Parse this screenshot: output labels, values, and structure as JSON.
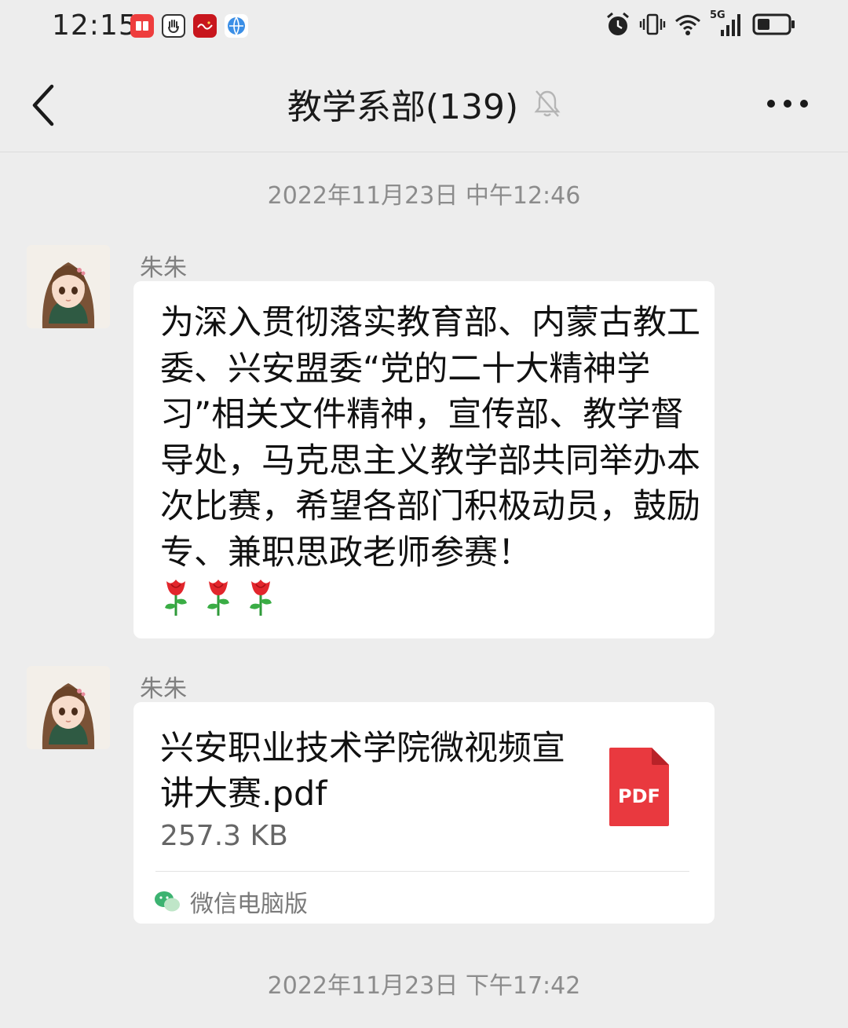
{
  "status_bar": {
    "time": "12:15",
    "network": "5G",
    "icons": [
      "reader-app-icon",
      "hand-app-icon",
      "study-app-icon",
      "globe-app-icon",
      "alarm-icon",
      "vibrate-icon",
      "wifi-icon",
      "signal-icon",
      "battery-icon"
    ]
  },
  "nav": {
    "title": "教学系部(139)",
    "muted_icon": "bell-muted-icon",
    "back_icon": "chevron-left-icon",
    "more_icon": "more-dots-icon"
  },
  "messages": [
    {
      "timestamp": "2022年11月23日 中午12:46",
      "sender": "朱朱",
      "text": "为深入贯彻落实教育部、内蒙古教工委、兴安盟委“党的二十大精神学习”相关文件精神，宣传部、教学督导处，马克思主义教学部共同举办本次比赛，希望各部门积极动员，鼓励专、兼职思政老师参赛！",
      "emoji": [
        "rose-icon",
        "rose-icon",
        "rose-icon"
      ]
    },
    {
      "sender": "朱朱",
      "file": {
        "name": "兴安职业技术学院微视频宣讲大赛.pdf",
        "size": "257.3 KB",
        "type_label": "PDF",
        "source": "微信电脑版"
      }
    }
  ],
  "footer_timestamp": "2022年11月23日 下午17:42",
  "colors": {
    "background": "#ededed",
    "bubble": "#ffffff",
    "pdf_red": "#e9393f",
    "wechat_green": "#3cb371"
  }
}
